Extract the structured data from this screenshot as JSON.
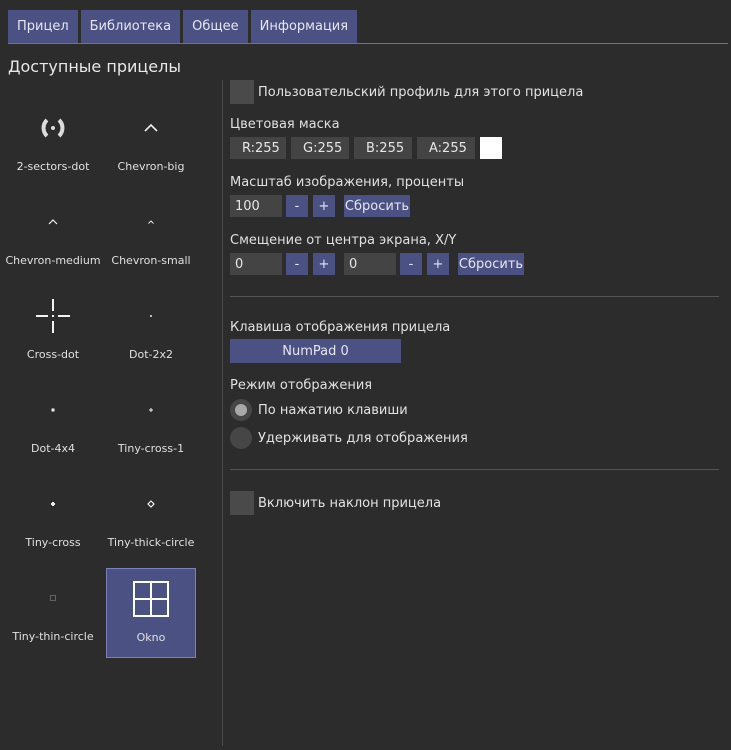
{
  "tabs": [
    "Прицел",
    "Библиотека",
    "Общее",
    "Информация"
  ],
  "section_title": "Доступные прицелы",
  "crosshairs": [
    {
      "name": "2-sectors-dot",
      "icon": "two-sectors-dot-icon"
    },
    {
      "name": "Chevron-big",
      "icon": "chevron-big-icon"
    },
    {
      "name": "Chevron-medium",
      "icon": "chevron-medium-icon"
    },
    {
      "name": "Chevron-small",
      "icon": "chevron-small-icon"
    },
    {
      "name": "Cross-dot",
      "icon": "cross-dot-icon"
    },
    {
      "name": "Dot-2x2",
      "icon": "dot-2x2-icon"
    },
    {
      "name": "Dot-4x4",
      "icon": "dot-4x4-icon"
    },
    {
      "name": "Tiny-cross-1",
      "icon": "tiny-cross-1-icon"
    },
    {
      "name": "Tiny-cross",
      "icon": "tiny-cross-icon"
    },
    {
      "name": "Tiny-thick-circle",
      "icon": "tiny-thick-circle-icon"
    },
    {
      "name": "Tiny-thin-circle",
      "icon": "tiny-thin-circle-icon"
    },
    {
      "name": "Okno",
      "icon": "okno-window-icon",
      "selected": true
    }
  ],
  "settings": {
    "custom_profile_label": "Пользовательский профиль для этого прицела",
    "color_mask_label": "Цветовая маска",
    "color_mask": {
      "r": "R:255",
      "g": "G:255",
      "b": "B:255",
      "a": "A:255",
      "swatch": "#ffffff"
    },
    "scale_label": "Масштаб изображения, проценты",
    "scale_value": "100",
    "minus": "-",
    "plus": "+",
    "reset": "Сбросить",
    "offset_label": "Смещение от центра экрана, X/Y",
    "offset_x": "0",
    "offset_y": "0",
    "hotkey_label": "Клавиша отображения прицела",
    "hotkey_value": "NumPad 0",
    "mode_label": "Режим отображения",
    "mode_options": [
      "По нажатию клавиши",
      "Удерживать для отображения"
    ],
    "mode_selected": 0,
    "tilt_label": "Включить наклон прицела"
  },
  "colors": {
    "accent": "#4c5184",
    "background": "#2c2c2c"
  }
}
